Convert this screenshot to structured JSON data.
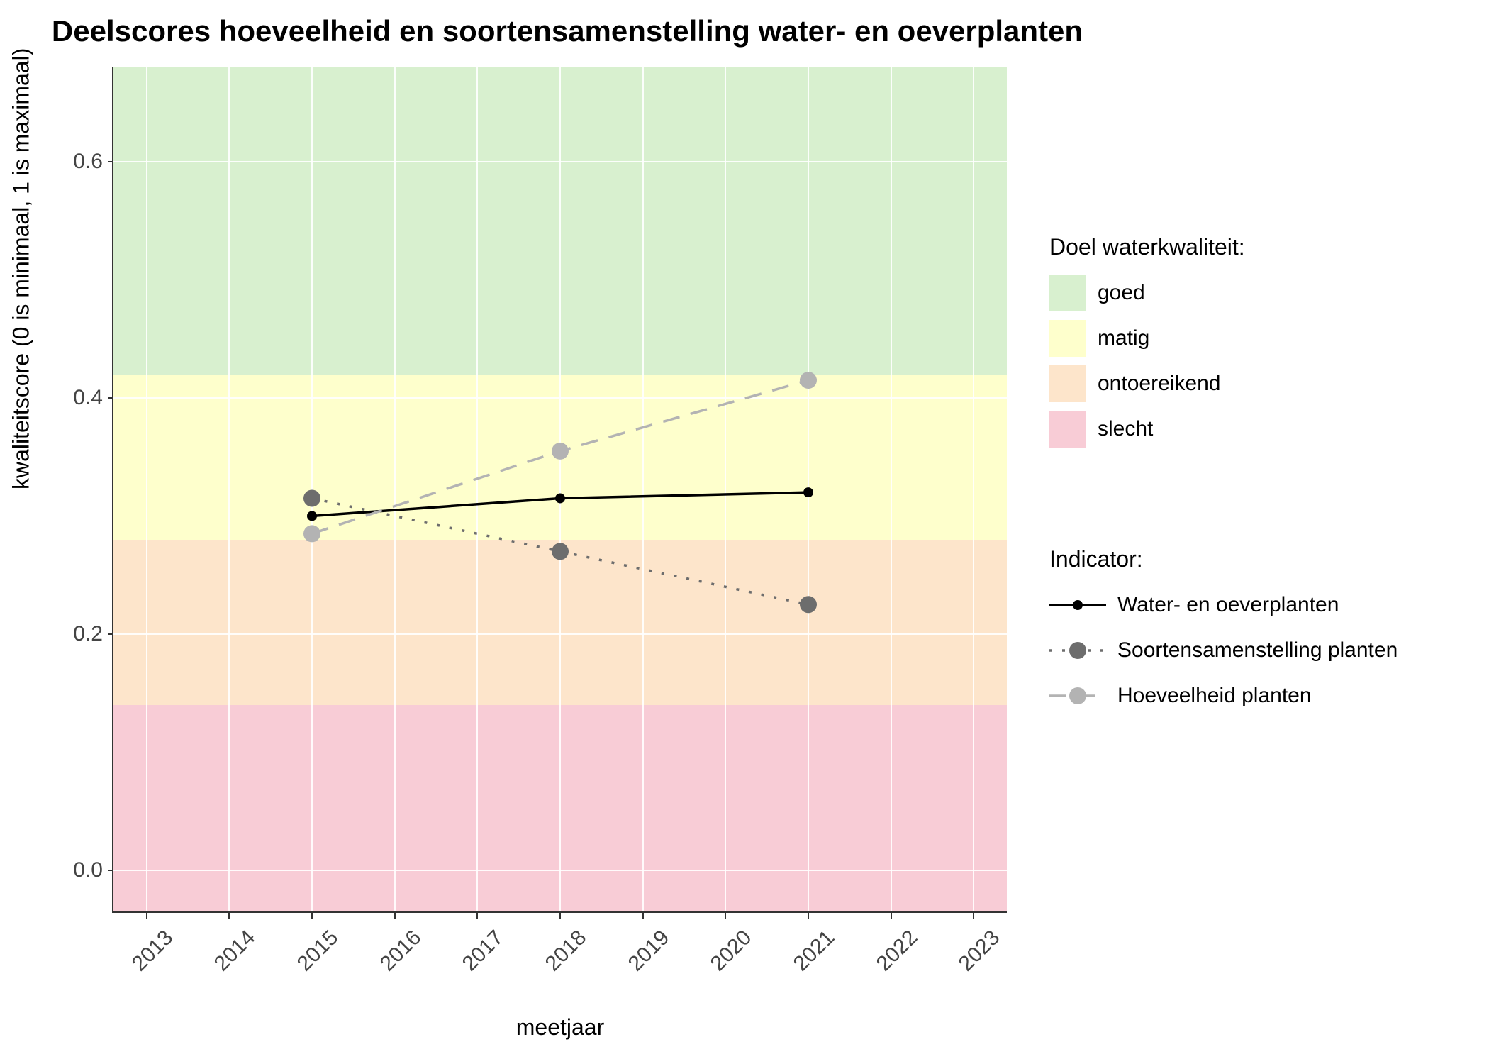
{
  "chart_data": {
    "type": "line",
    "title": "Deelscores hoeveelheid en soortensamenstelling water- en oeverplanten",
    "xlabel": "meetjaar",
    "ylabel": "kwaliteitscore (0 is minimaal, 1 is maximaal)",
    "x_ticks": [
      2013,
      2014,
      2015,
      2016,
      2017,
      2018,
      2019,
      2020,
      2021,
      2022,
      2023
    ],
    "y_ticks": [
      0.0,
      0.2,
      0.4,
      0.6
    ],
    "xlim": [
      2012.6,
      2023.4
    ],
    "ylim": [
      -0.035,
      0.68
    ],
    "bands": [
      {
        "name": "goed",
        "from": 0.42,
        "to": 0.68,
        "color": "#d8f0cf"
      },
      {
        "name": "matig",
        "from": 0.28,
        "to": 0.42,
        "color": "#feffcc"
      },
      {
        "name": "ontoereikend",
        "from": 0.14,
        "to": 0.28,
        "color": "#fde5cb"
      },
      {
        "name": "slecht",
        "from": -0.035,
        "to": 0.14,
        "color": "#f8ccd6"
      }
    ],
    "x": [
      2015,
      2018,
      2021
    ],
    "series": [
      {
        "name": "Water- en oeverplanten",
        "values": [
          0.3,
          0.315,
          0.32
        ],
        "color": "#000000",
        "dash": "solid",
        "marker": "small"
      },
      {
        "name": "Soortensamenstelling planten",
        "values": [
          0.315,
          0.27,
          0.225
        ],
        "color": "#6d6d6d",
        "dash": "dotted",
        "marker": "large"
      },
      {
        "name": "Hoeveelheid planten",
        "values": [
          0.285,
          0.355,
          0.415
        ],
        "color": "#b3b3b3",
        "dash": "dashed",
        "marker": "large"
      }
    ],
    "legend_quality_title": "Doel waterkwaliteit:",
    "legend_quality": [
      "goed",
      "matig",
      "ontoereikend",
      "slecht"
    ],
    "legend_indicator_title": "Indicator:",
    "colors": {
      "goed": "#d8f0cf",
      "matig": "#feffcc",
      "ontoereikend": "#fde5cb",
      "slecht": "#f8ccd6"
    }
  }
}
